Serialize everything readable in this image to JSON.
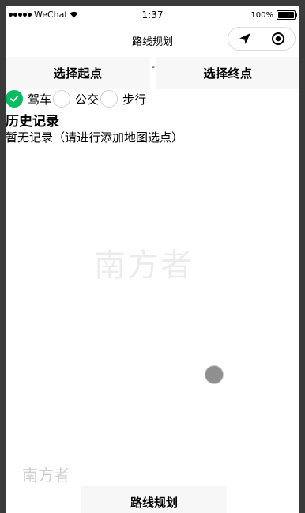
{
  "status_bar": {
    "carrier": "WeChat",
    "time": "1:37",
    "battery": "100%"
  },
  "nav": {
    "title": "路线规划"
  },
  "points": {
    "start_label": "选择起点",
    "separator": "-",
    "end_label": "选择终点"
  },
  "modes": [
    {
      "label": "驾车",
      "checked": true
    },
    {
      "label": "公交",
      "checked": false
    },
    {
      "label": "步行",
      "checked": false
    }
  ],
  "history": {
    "title": "历史记录",
    "empty_text": "暂无记录（请进行添加地图选点）"
  },
  "watermark": {
    "center": "南方者",
    "bottom": "南方者"
  },
  "route_button": {
    "label": "路线规划"
  },
  "colors": {
    "accent": "#09bb62",
    "button_bg": "#f7f7f7",
    "float_dot": "#8f8f8f"
  }
}
